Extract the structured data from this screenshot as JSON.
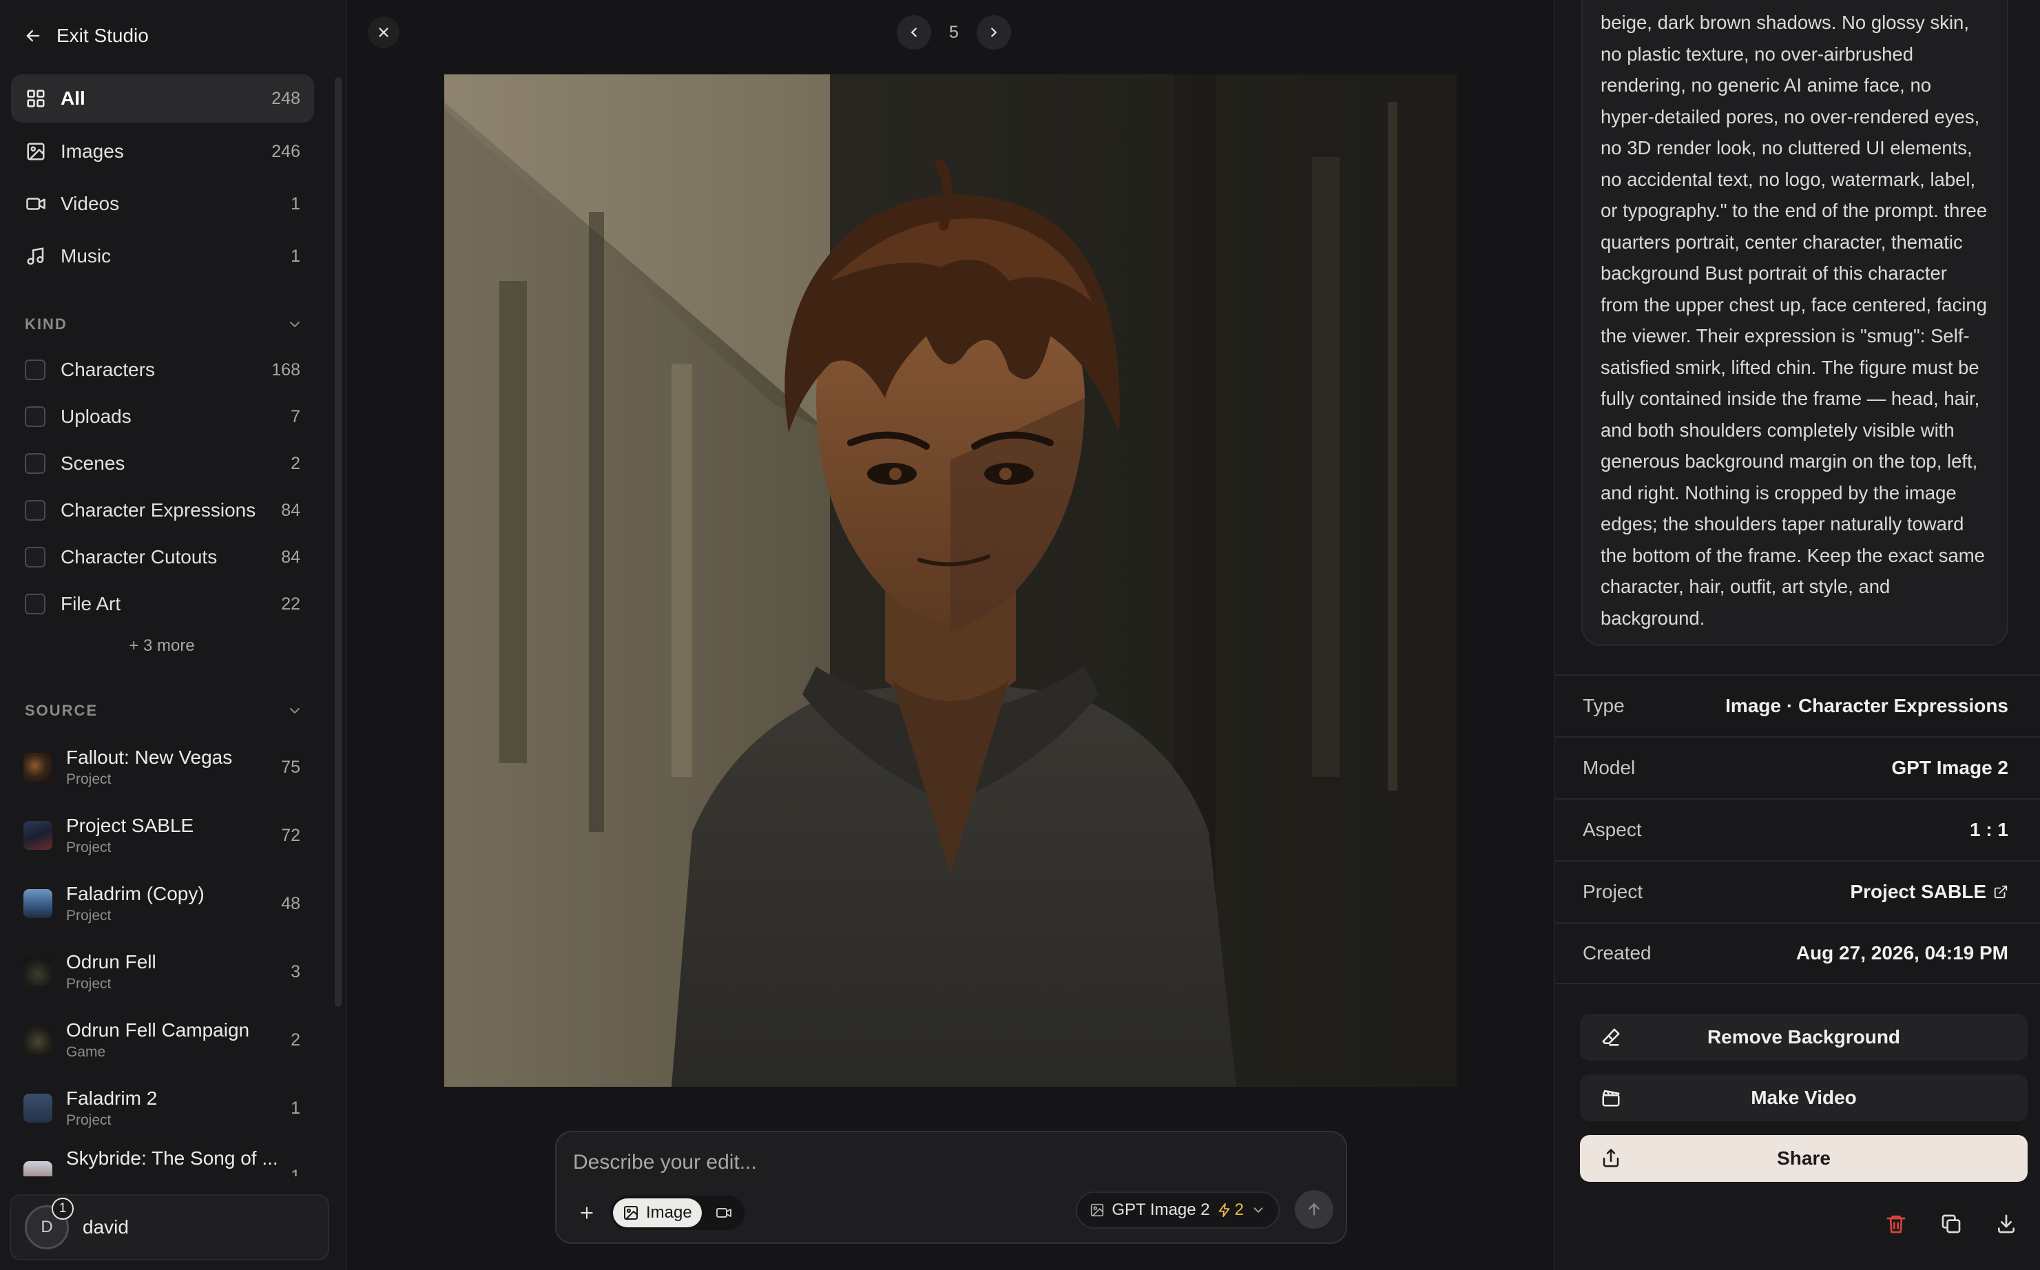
{
  "sidebar": {
    "exit_label": "Exit Studio",
    "nav": [
      {
        "label": "All",
        "count": "248",
        "icon": "grid-icon"
      },
      {
        "label": "Images",
        "count": "246",
        "icon": "image-icon"
      },
      {
        "label": "Videos",
        "count": "1",
        "icon": "video-icon"
      },
      {
        "label": "Music",
        "count": "1",
        "icon": "music-icon"
      }
    ],
    "kind_header": "KIND",
    "kinds": [
      {
        "label": "Characters",
        "count": "168"
      },
      {
        "label": "Uploads",
        "count": "7"
      },
      {
        "label": "Scenes",
        "count": "2"
      },
      {
        "label": "Character Expressions",
        "count": "84"
      },
      {
        "label": "Character Cutouts",
        "count": "84"
      },
      {
        "label": "File Art",
        "count": "22"
      }
    ],
    "more_label": "+ 3 more",
    "source_header": "SOURCE",
    "sources": [
      {
        "name": "Fallout: New Vegas",
        "sub": "Project",
        "count": "75"
      },
      {
        "name": "Project SABLE",
        "sub": "Project",
        "count": "72"
      },
      {
        "name": "Faladrim (Copy)",
        "sub": "Project",
        "count": "48"
      },
      {
        "name": "Odrun Fell",
        "sub": "Project",
        "count": "3"
      },
      {
        "name": "Odrun Fell Campaign",
        "sub": "Game",
        "count": "2"
      },
      {
        "name": "Faladrim 2",
        "sub": "Project",
        "count": "1"
      },
      {
        "name": "Skybride: The Song of ...",
        "sub": "",
        "count": "1"
      }
    ],
    "user": {
      "initial": "D",
      "name": "david",
      "badge": "1"
    }
  },
  "viewer": {
    "page": "5"
  },
  "composer": {
    "placeholder": "Describe your edit...",
    "mode_image": "Image",
    "model": "GPT Image 2",
    "cost": "2"
  },
  "details": {
    "prompt_text": "beige, dark brown shadows. No glossy skin, no plastic texture, no over-airbrushed rendering, no generic AI anime face, no hyper-detailed pores, no over-rendered eyes, no 3D render look, no cluttered UI elements, no accidental text, no logo, watermark, label, or typography.\" to the end of the prompt. three quarters portrait, center character, thematic background Bust portrait of this character from the upper chest up, face centered, facing the viewer. Their expression is \"smug\": Self-satisfied smirk, lifted chin. The figure must be fully contained inside the frame — head, hair, and both shoulders completely visible with generous background margin on the top, left, and right. Nothing is cropped by the image edges; the shoulders taper naturally toward the bottom of the frame. Keep the exact same character, hair, outfit, art style, and background.",
    "meta": [
      {
        "label": "Type",
        "value": "Image · Character Expressions"
      },
      {
        "label": "Model",
        "value": "GPT Image 2"
      },
      {
        "label": "Aspect",
        "value": "1 : 1"
      },
      {
        "label": "Project",
        "value": "Project SABLE"
      },
      {
        "label": "Created",
        "value": "Aug 27, 2026, 04:19 PM"
      }
    ],
    "actions": {
      "remove_bg": "Remove Background",
      "make_video": "Make Video",
      "share": "Share"
    }
  },
  "colors": {
    "background": "#151517",
    "panel": "#18181a",
    "accent_light": "#ece4dd",
    "cost_yellow": "#e6b94a",
    "delete_red": "#d9443a"
  }
}
